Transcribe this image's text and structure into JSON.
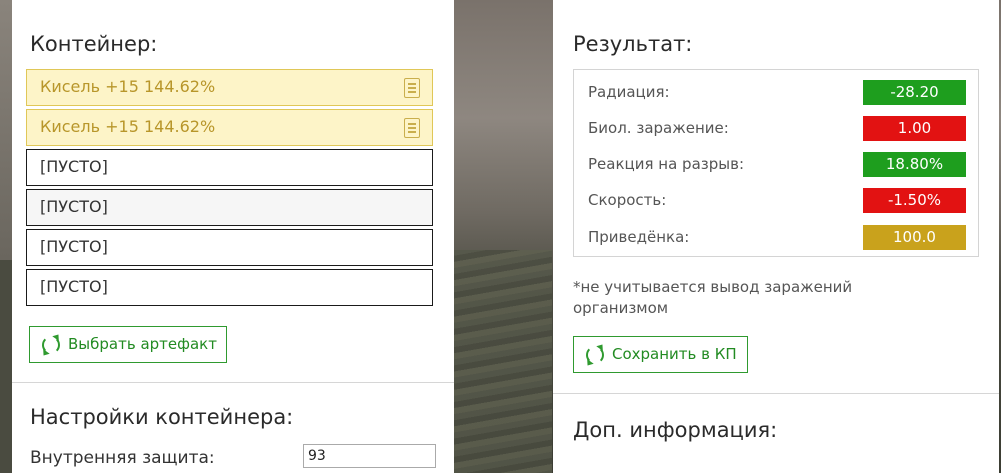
{
  "container": {
    "title": "Контейнер:",
    "slots": [
      {
        "label": "Кисель +15 144.62%",
        "filled": true
      },
      {
        "label": "Кисель +15 144.62%",
        "filled": true
      },
      {
        "label": "[ПУСТО]",
        "filled": false
      },
      {
        "label": "[ПУСТО]",
        "filled": false
      },
      {
        "label": "[ПУСТО]",
        "filled": false
      },
      {
        "label": "[ПУСТО]",
        "filled": false
      }
    ],
    "choose_button": "Выбрать артефакт",
    "slot_icon": "document-icon"
  },
  "container_settings": {
    "title": "Настройки контейнера:",
    "inner_protection_label": "Внутренняя защита:",
    "inner_protection_value": "93"
  },
  "result": {
    "title": "Результат:",
    "rows": [
      {
        "label": "Радиация:",
        "value": "-28.20",
        "color": "#1e9e1e"
      },
      {
        "label": "Биол. заражение:",
        "value": "1.00",
        "color": "#e21212"
      },
      {
        "label": "Реакция на разрыв:",
        "value": "18.80%",
        "color": "#1e9e1e"
      },
      {
        "label": "Скорость:",
        "value": "-1.50%",
        "color": "#e21212"
      },
      {
        "label": "Приведёнка:",
        "value": "100.0",
        "color": "#c9a21c"
      }
    ],
    "note": "*не учитывается вывод заражений организмом",
    "save_button": "Сохранить в КП",
    "button_icon": "refresh-icon"
  },
  "extra_info": {
    "title": "Доп. информация:"
  },
  "colors": {
    "accent_green": "#2f9a2f",
    "slot_filled_bg": "#fdf4c8",
    "slot_filled_border": "#e0c757"
  }
}
